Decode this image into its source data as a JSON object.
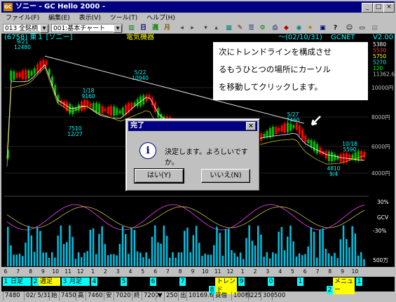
{
  "window": {
    "title": "ソニー - GC Hello 2000 -",
    "app_icon": "GC"
  },
  "menu": [
    "ファイル(F)",
    "編集(E)",
    "表示(V)",
    "ツール(T)",
    "ヘルプ(H)"
  ],
  "toolbar": {
    "list_combo": "013 全銘柄",
    "chart_combo": "001:基本チャート",
    "day_button": "日",
    "week_button": "週",
    "month_button": "月"
  },
  "chart_header": {
    "left": "(6758) 東１ [ソニー]",
    "sector": "電気機器",
    "date": "～(02/10/31)",
    "source": "GCNET",
    "version": "V2.00"
  },
  "price_panel": {
    "right_values": [
      "5380",
      "5530",
      "5750",
      "5270",
      "120",
      "11362.6"
    ],
    "axis_labels": [
      "10000円",
      "8000円",
      "6000円",
      "4000円"
    ]
  },
  "annotations": {
    "high_left": "9/21\n12480",
    "date_5_22": "5/22\n10940",
    "date_1_18": "1/18\n9160",
    "low_7510": "7510\n12/27",
    "date_5_27": "5/27\n7460",
    "date_10_18": "10/18\n5590",
    "low_4810": "4810\n9/4"
  },
  "callout": {
    "lines": [
      "次にトレンドラインを構成させ",
      "るもうひとつの場所にカーソル",
      "を移動してクリックします。"
    ]
  },
  "osc_labels": [
    "30%",
    "GCV",
    "-30%"
  ],
  "volume_label": "500万",
  "month_axis": [
    "6",
    "7",
    "8",
    "9",
    "10",
    "11",
    "12",
    "1",
    "2",
    "3",
    "4",
    "5",
    "6",
    "7",
    "8",
    "9",
    "10",
    "11",
    "12",
    "1",
    "2",
    "3",
    "4",
    "5",
    "6",
    "7",
    "8",
    "9",
    "10"
  ],
  "tabs": [
    {
      "num": "1",
      "label": "日足"
    },
    {
      "num": "2",
      "label": "週足"
    },
    {
      "num": "3",
      "label": "月足"
    },
    {
      "num": "4",
      "label": ""
    },
    {
      "num": "5",
      "label": ""
    },
    {
      "num": "6",
      "label": ""
    },
    {
      "num": "7",
      "label": ""
    },
    {
      "num": "8",
      "label": "トレンド"
    },
    {
      "num": "9",
      "label": ""
    },
    {
      "num": "0",
      "label": ""
    },
    {
      "num": "1",
      "label": ""
    },
    {
      "num": "2",
      "label": "メニュー"
    },
    {
      "num": "1",
      "label": ""
    }
  ],
  "status": [
    "7480",
    "02/ 5/31",
    "始",
    "7450",
    "高",
    "7460",
    "安",
    "7020",
    "終",
    "7200",
    "▼",
    "250",
    "出",
    "10169.6",
    "貸借",
    "100株",
    "225",
    "300",
    "500"
  ],
  "dialog": {
    "title": "完了",
    "message": "決定します。よろしいですか。",
    "yes": "はい(Y)",
    "no": "いいえ(N)",
    "info_icon": "i"
  },
  "colors": {
    "title_bar": "#000080",
    "chart_bg": "#000000",
    "header_text": "#00ffff",
    "candle_green": "#00c000",
    "candle_red": "#ff0000",
    "volume": "#00ffff",
    "osc_line": "#ff40ff"
  }
}
